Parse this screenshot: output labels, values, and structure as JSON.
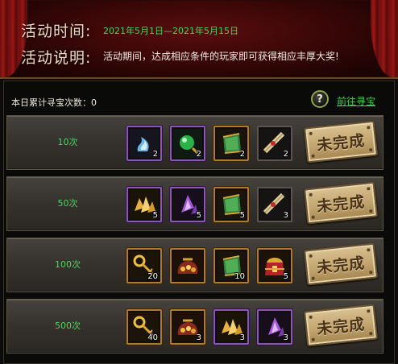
{
  "header": {
    "time_label": "活动时间:",
    "time_value": "2021年5月1日—2021年5月15日",
    "desc_label": "活动说明:",
    "desc_value": "活动期间，达成相应条件的玩家即可获得相应丰厚大奖!"
  },
  "summary": {
    "count_text": "本日累计寻宝次数：0",
    "help_symbol": "?",
    "go_link": "前往寻宝"
  },
  "rows": [
    {
      "tier": "10次",
      "status": "未完成",
      "items": [
        {
          "icon": "blue-spirit-icon",
          "qty": "2",
          "quality": "purple"
        },
        {
          "icon": "green-orb-icon",
          "qty": "2",
          "quality": "purple"
        },
        {
          "icon": "jade-armor-icon",
          "qty": "2",
          "quality": "orange"
        },
        {
          "icon": "scroll-icon",
          "qty": "2",
          "quality": "plain"
        }
      ]
    },
    {
      "tier": "50次",
      "status": "未完成",
      "items": [
        {
          "icon": "gold-crystal-icon",
          "qty": "5",
          "quality": "purple"
        },
        {
          "icon": "purple-crystal-icon",
          "qty": "5",
          "quality": "purple"
        },
        {
          "icon": "jade-armor-icon",
          "qty": "5",
          "quality": "orange"
        },
        {
          "icon": "scroll-icon",
          "qty": "3",
          "quality": "plain"
        }
      ]
    },
    {
      "tier": "100次",
      "status": "未完成",
      "items": [
        {
          "icon": "gold-key-icon",
          "qty": "20",
          "quality": "orange"
        },
        {
          "icon": "treasure-bag-icon",
          "qty": "",
          "quality": "orange"
        },
        {
          "icon": "jade-armor-icon",
          "qty": "10",
          "quality": "orange"
        },
        {
          "icon": "golden-chest-icon",
          "qty": "5",
          "quality": "orange"
        }
      ]
    },
    {
      "tier": "500次",
      "status": "未完成",
      "items": [
        {
          "icon": "gold-key-icon",
          "qty": "40",
          "quality": "orange"
        },
        {
          "icon": "treasure-bag-icon",
          "qty": "3",
          "quality": "orange"
        },
        {
          "icon": "gold-crystal-icon",
          "qty": "3",
          "quality": "purple"
        },
        {
          "icon": "purple-crystal-icon",
          "qty": "3",
          "quality": "purple"
        }
      ]
    }
  ]
}
